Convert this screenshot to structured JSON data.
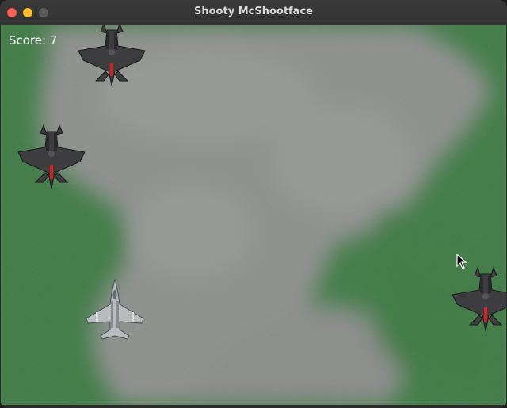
{
  "window": {
    "title": "Shooty McShootface"
  },
  "hud": {
    "score_text": "Score: 7"
  },
  "colors": {
    "grass": "#3f7a45",
    "cloud": "#8f918f",
    "enemy_body": "#3d3d40",
    "enemy_accent": "#d32020",
    "player_body": "#b9bcbf"
  },
  "sprites": {
    "enemy_icon": "enemy-jet-icon",
    "player_icon": "player-jet-icon",
    "cursor_icon": "mouse-pointer-icon"
  }
}
